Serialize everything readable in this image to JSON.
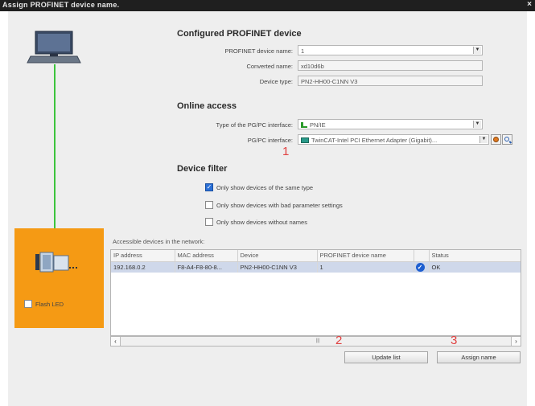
{
  "window": {
    "title": "Assign PROFINET device name.",
    "close": "×"
  },
  "configured": {
    "heading": "Configured PROFINET device",
    "name_label": "PROFINET device name:",
    "name_value": "1",
    "converted_label": "Converted name:",
    "converted_value": "xd10d6b",
    "type_label": "Device type:",
    "type_value": "PN2-HH00-C1NN V3"
  },
  "online": {
    "heading": "Online access",
    "iface_type_label": "Type of the PG/PC interface:",
    "iface_type_value": "PN/IE",
    "iface_label": "PG/PC interface:",
    "iface_value": "TwinCAT-Intel PCI Ethernet Adapter (Gigabit)..."
  },
  "filter": {
    "heading": "Device filter",
    "options": [
      {
        "label": "Only show devices of the same type",
        "checked": true
      },
      {
        "label": "Only show devices with bad parameter settings",
        "checked": false
      },
      {
        "label": "Only show devices without names",
        "checked": false
      }
    ]
  },
  "network": {
    "caption": "Accessible devices in the network:",
    "columns": [
      "IP address",
      "MAC address",
      "Device",
      "PROFINET device name",
      "",
      "Status"
    ],
    "rows": [
      {
        "ip": "192.168.0.2",
        "mac": "F8-A4-F8-80-8...",
        "device": "PN2-HH00-C1NN V3",
        "name": "1",
        "status": "OK"
      }
    ]
  },
  "device_panel": {
    "flash_label": "Flash LED"
  },
  "buttons": {
    "update": "Update list",
    "assign": "Assign name"
  },
  "annotations": {
    "one": "1",
    "two": "2",
    "three": "3"
  },
  "colors": {
    "link_line": "#3cc43c",
    "device_panel": "#f59a14",
    "status_ok": "#1e5fd0",
    "annotation": "#e04040"
  }
}
